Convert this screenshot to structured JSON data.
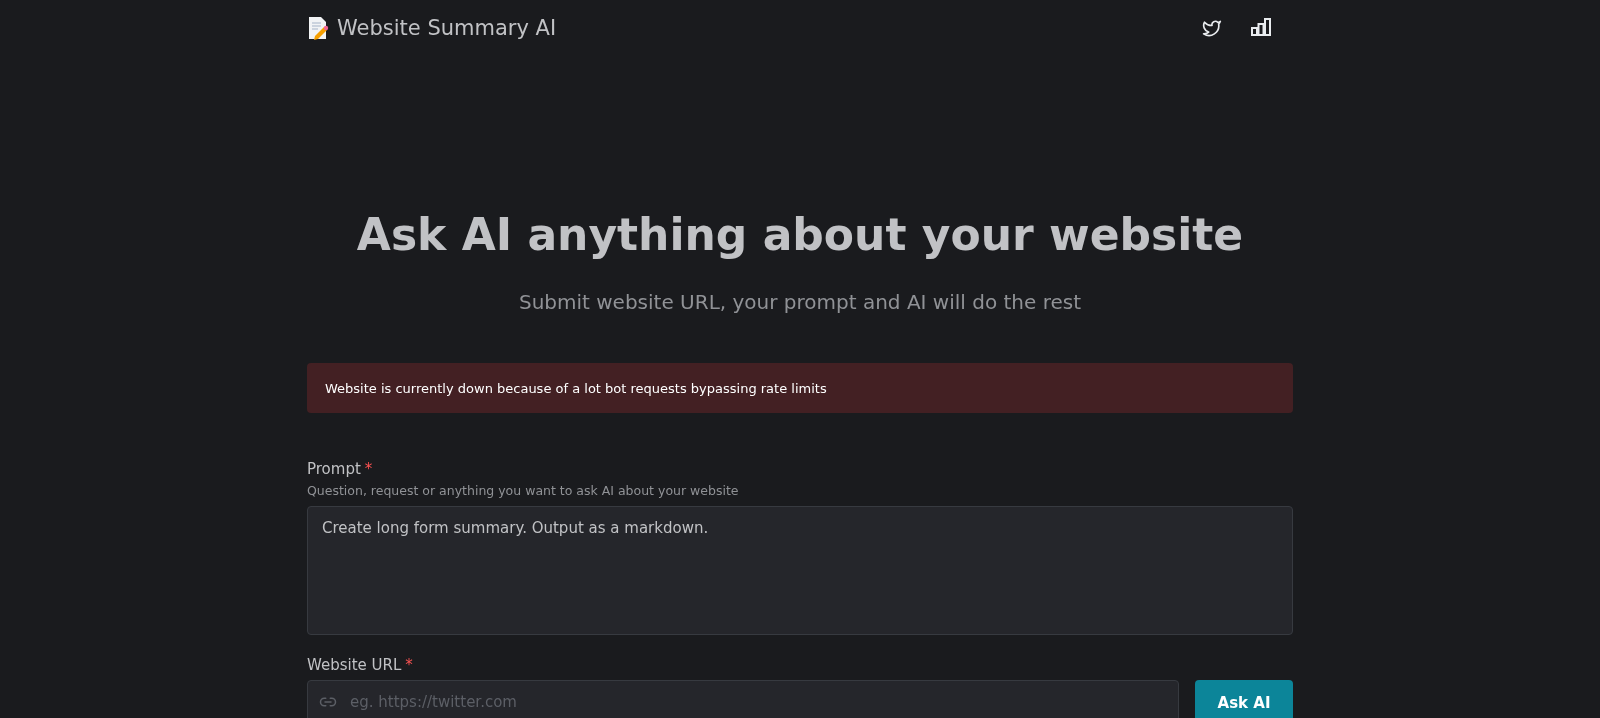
{
  "header": {
    "title": "Website Summary AI"
  },
  "hero": {
    "heading": "Ask AI anything about your website",
    "subtitle": "Submit website URL, your prompt and AI will do the rest"
  },
  "alert": {
    "message": "Website is currently down because of a lot bot requests bypassing rate limits"
  },
  "prompt_field": {
    "label": "Prompt",
    "required_mark": "*",
    "hint": "Question, request or anything you want to ask AI about your website",
    "value": "Create long form summary. Output as a markdown."
  },
  "url_field": {
    "label": "Website URL",
    "required_mark": "*",
    "placeholder": "eg. https://twitter.com"
  },
  "submit_button": {
    "label": "Ask AI"
  }
}
